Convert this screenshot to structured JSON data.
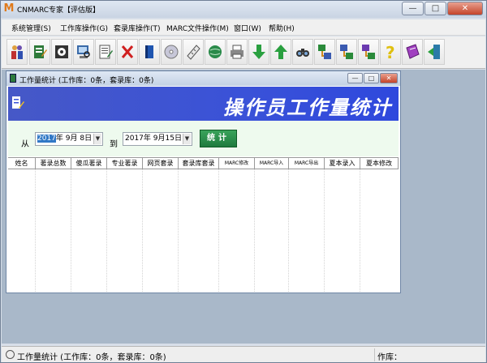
{
  "app": {
    "title": "CNMARC专家【评估版】",
    "logo": "M"
  },
  "window_controls": {
    "minimize": "—",
    "maximize": "□",
    "close": "✕"
  },
  "menu": [
    {
      "label": "系统管理(S)"
    },
    {
      "label": "工作库操作(G)"
    },
    {
      "label": "套录库操作(T)"
    },
    {
      "label": "MARC文件操作(M)"
    },
    {
      "label": "窗口(W)"
    },
    {
      "label": "帮助(H)"
    }
  ],
  "toolbar": [
    {
      "icon": "users-icon"
    },
    {
      "icon": "edit-record-icon"
    },
    {
      "icon": "catalog-list-icon"
    },
    {
      "icon": "computer-search-icon"
    },
    {
      "icon": "document-edit-icon"
    },
    {
      "icon": "delete-icon"
    },
    {
      "icon": "book-icon"
    },
    {
      "icon": "cd-disc-icon"
    },
    {
      "icon": "ruler-icon"
    },
    {
      "icon": "globe-icon"
    },
    {
      "icon": "printer-icon"
    },
    {
      "icon": "download-arrow-icon"
    },
    {
      "icon": "upload-arrow-icon"
    },
    {
      "icon": "binoculars-icon"
    },
    {
      "icon": "marc-export-icon"
    },
    {
      "icon": "marc-import-icon"
    },
    {
      "icon": "marc-convert-icon"
    },
    {
      "icon": "help-icon"
    },
    {
      "icon": "notebook-icon"
    },
    {
      "icon": "exit-icon"
    }
  ],
  "child_window": {
    "title": "工作量统计  (工作库：0条，套录库：0条)",
    "banner_title": "操作员工作量统计",
    "from_label": "从",
    "to_label": "到",
    "from_date_year": "2017",
    "from_date_rest": "年  9月  8日",
    "to_date": "2017年  9月15日",
    "stat_button": "统计",
    "columns": [
      "姓名",
      "著录总数",
      "傻瓜著录",
      "专业著录",
      "网页套录",
      "套录库套录",
      "MARC修改",
      "MARC导入",
      "MARC导出",
      "夏本录入",
      "夏本修改"
    ]
  },
  "status": {
    "text": "工作量统计  (工作库：0条，套录库：0条)",
    "right": "作库："
  }
}
